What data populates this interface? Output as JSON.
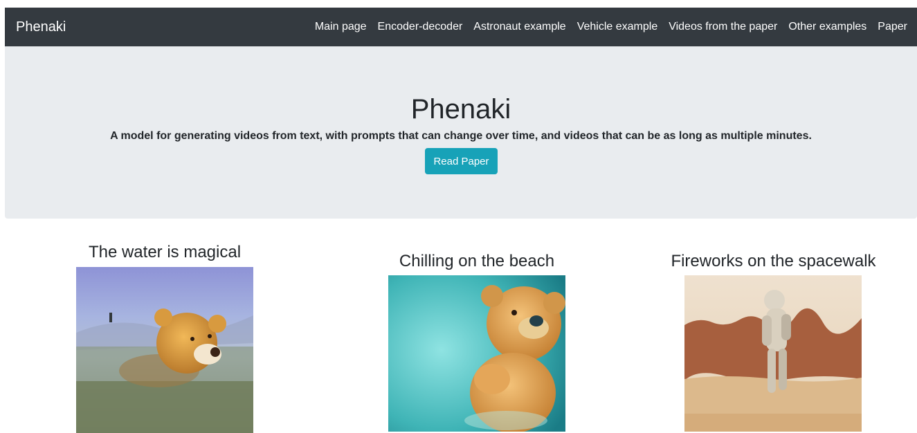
{
  "navbar": {
    "brand": "Phenaki",
    "links": [
      "Main page",
      "Encoder-decoder",
      "Astronaut example",
      "Vehicle example",
      "Videos from the paper",
      "Other examples",
      "Paper"
    ]
  },
  "hero": {
    "title": "Phenaki",
    "subtitle": "A model for generating videos from text, with prompts that can change over time, and videos that can be as long as multiple minutes.",
    "button_label": "Read Paper",
    "button_color": "#17a2b8"
  },
  "examples": [
    {
      "title": "The water is magical"
    },
    {
      "title": "Chilling on the beach"
    },
    {
      "title": "Fireworks on the spacewalk"
    }
  ],
  "colors": {
    "navbar_bg": "#343a40",
    "hero_bg": "#e9ecef"
  }
}
